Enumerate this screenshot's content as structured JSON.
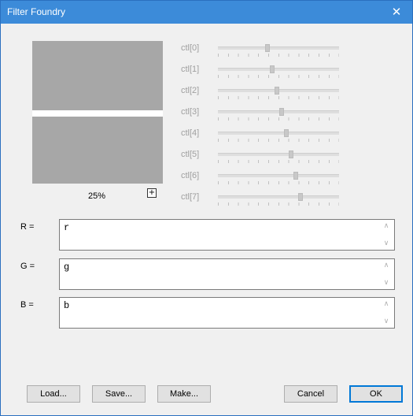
{
  "window": {
    "title": "Filter Foundry",
    "close_glyph": "✕"
  },
  "preview": {
    "zoom": "25%",
    "zoom_button": "+"
  },
  "controls": [
    {
      "label": "ctl[0]",
      "value": 0.4
    },
    {
      "label": "ctl[1]",
      "value": 0.44
    },
    {
      "label": "ctl[2]",
      "value": 0.48
    },
    {
      "label": "ctl[3]",
      "value": 0.52
    },
    {
      "label": "ctl[4]",
      "value": 0.56
    },
    {
      "label": "ctl[5]",
      "value": 0.6
    },
    {
      "label": "ctl[6]",
      "value": 0.64
    },
    {
      "label": "ctl[7]",
      "value": 0.68
    }
  ],
  "expressions": [
    {
      "label": "R =",
      "value": "r"
    },
    {
      "label": "G =",
      "value": "g"
    },
    {
      "label": "B =",
      "value": "b"
    }
  ],
  "buttons": {
    "load": "Load...",
    "save": "Save...",
    "make": "Make...",
    "cancel": "Cancel",
    "ok": "OK"
  }
}
